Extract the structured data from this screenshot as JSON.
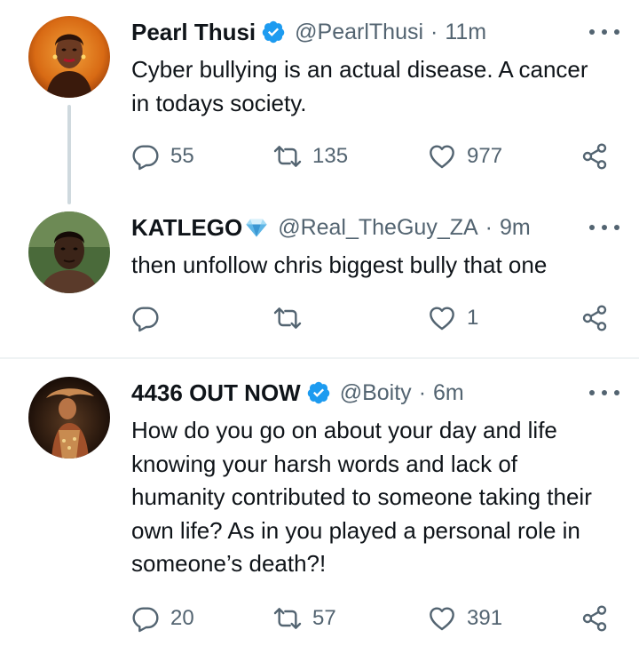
{
  "tweets": [
    {
      "name": "Pearl Thusi",
      "handle": "@PearlThusi",
      "separator": "·",
      "time": "11m",
      "text": "Cyber bullying is an actual disease. A cancer in todays society.",
      "replies": "55",
      "retweets": "135",
      "likes": "977",
      "badge": "verified-icon"
    },
    {
      "name": "KATLEGO",
      "handle": "@Real_TheGuy_ZA",
      "separator": "·",
      "time": "9m",
      "text": "then unfollow chris biggest bully that one",
      "replies": "",
      "retweets": "",
      "likes": "1",
      "badge": "diamond-emoji-icon"
    },
    {
      "name": "4436 OUT NOW",
      "handle": "@Boity",
      "separator": "·",
      "time": "6m",
      "text": "How do you go on about your day and life knowing your harsh words and lack of humanity contributed to someone taking their own life? As in you played a personal role in someone’s death?!",
      "replies": "20",
      "retweets": "57",
      "likes": "391",
      "badge": "verified-icon"
    }
  ],
  "colors": {
    "verified": "#1d9bf0",
    "secondary_text": "#536471",
    "primary_text": "#0f1419",
    "divider": "#eff3f4",
    "thread_line": "#cfd9de"
  }
}
